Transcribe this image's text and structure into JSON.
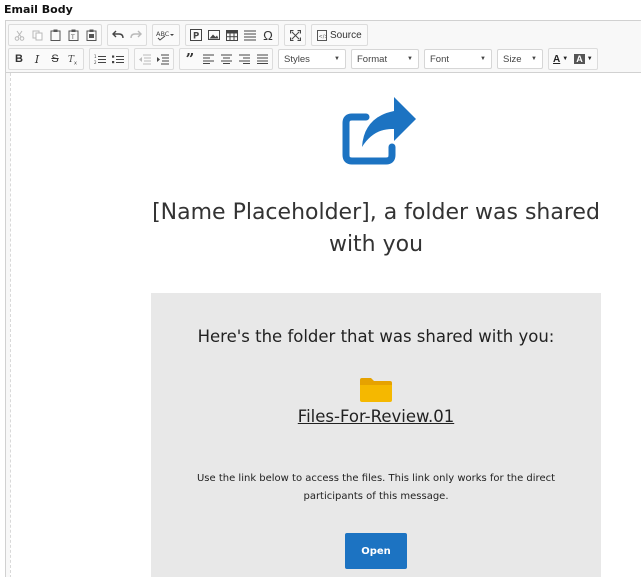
{
  "field": {
    "label": "Email Body"
  },
  "toolbar": {
    "source_label": "Source",
    "styles_label": "Styles",
    "format_label": "Format",
    "font_label": "Font",
    "size_label": "Size",
    "bold": "B",
    "italic": "I",
    "strike": "S",
    "text_color": "A",
    "bg_color": "A"
  },
  "email": {
    "headline": "[Name Placeholder], a folder was shared with you",
    "card_heading": "Here's the folder that was shared with you:",
    "folder_name": "Files-For-Review.01",
    "note": "Use the link below to access the files. This link only works for the direct participants of this message.",
    "open_button": "Open"
  },
  "colors": {
    "accent_blue": "#1c73c2",
    "folder_yellow": "#f5b800",
    "card_bg": "#e8e8e8"
  }
}
